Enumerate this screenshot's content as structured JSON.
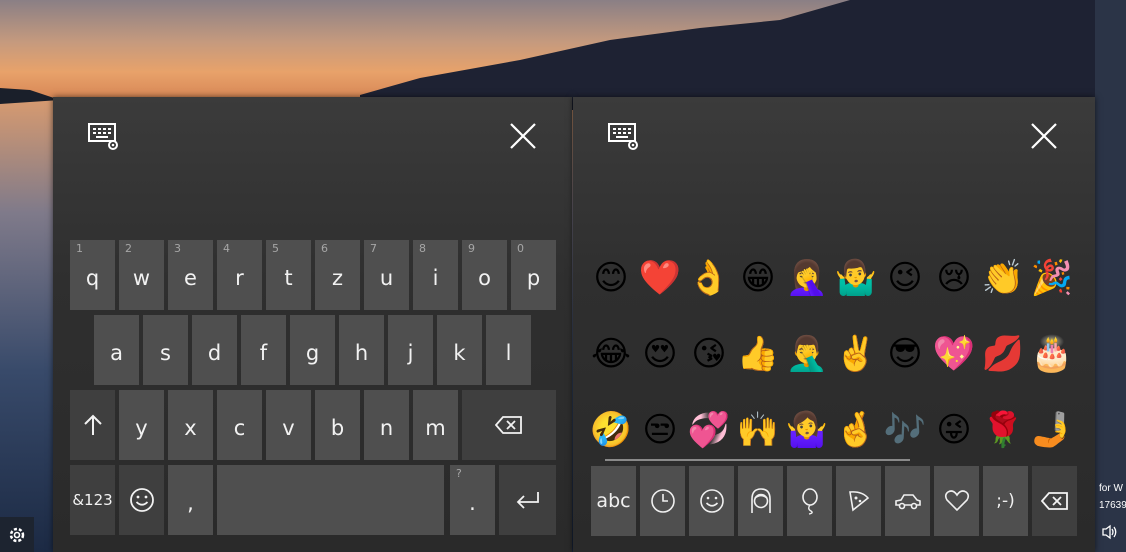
{
  "text_keyboard": {
    "row1": [
      {
        "hint": "1",
        "label": "q"
      },
      {
        "hint": "2",
        "label": "w"
      },
      {
        "hint": "3",
        "label": "e"
      },
      {
        "hint": "4",
        "label": "r"
      },
      {
        "hint": "5",
        "label": "t"
      },
      {
        "hint": "6",
        "label": "z"
      },
      {
        "hint": "7",
        "label": "u"
      },
      {
        "hint": "8",
        "label": "i"
      },
      {
        "hint": "9",
        "label": "o"
      },
      {
        "hint": "0",
        "label": "p"
      }
    ],
    "row2": [
      "a",
      "s",
      "d",
      "f",
      "g",
      "h",
      "j",
      "k",
      "l"
    ],
    "row3": [
      "y",
      "x",
      "c",
      "v",
      "b",
      "n",
      "m"
    ],
    "symbols_label": "&123",
    "comma_label": ",",
    "period_hint": "?",
    "period_label": "."
  },
  "emoji_keyboard": {
    "category_abc_label": "abc",
    "emoticon_label": ";-)",
    "emoji_rows": [
      [
        "😊",
        "❤️",
        "👌",
        "😁",
        "🤦‍♀️",
        "🤷‍♂️",
        "😉",
        "😢",
        "👏",
        "🎉"
      ],
      [
        "😂",
        "😍",
        "😘",
        "👍",
        "🤦‍♂️",
        "✌️",
        "😎",
        "💖",
        "💋",
        "🎂"
      ],
      [
        "🤣",
        "😒",
        "💞",
        "🙌",
        "🤷‍♀️",
        "🤞",
        "🎶",
        "😜",
        "🌹",
        "🤳"
      ]
    ]
  },
  "desktop": {
    "side_text_line1": "for W",
    "side_text_line2": "17639"
  }
}
